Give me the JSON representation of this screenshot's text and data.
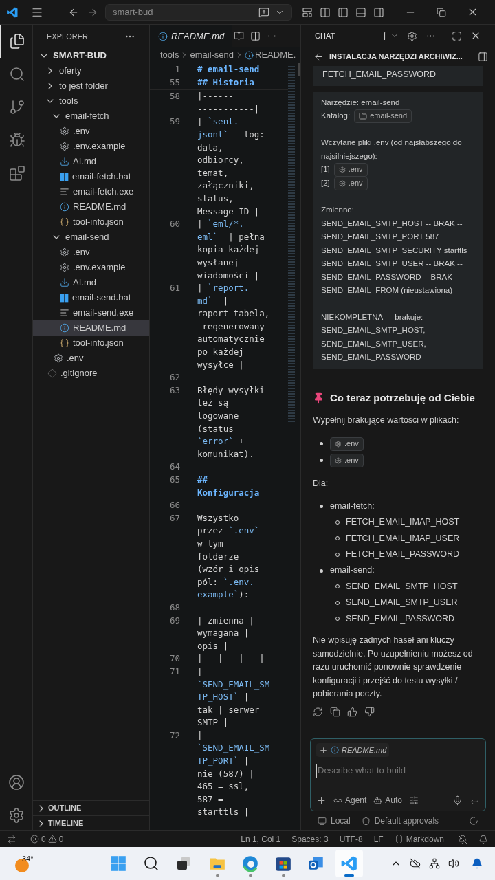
{
  "title_bar": {
    "command_center": "smart-bud"
  },
  "activity_bar": {
    "items": [
      {
        "kind": "explorer",
        "selected": true
      },
      {
        "kind": "search",
        "selected": false
      },
      {
        "kind": "scm",
        "selected": false
      },
      {
        "kind": "debug",
        "selected": false
      },
      {
        "kind": "extensions",
        "selected": false
      }
    ]
  },
  "explorer": {
    "title": "EXPLORER",
    "root": {
      "label": "SMART-BUD",
      "kind": "folder",
      "expanded": true,
      "selected": false,
      "children": [
        {
          "label": "oferty",
          "kind": "folder",
          "expanded": false,
          "selected": false
        },
        {
          "label": "to jest folder",
          "kind": "folder",
          "expanded": false,
          "selected": false
        },
        {
          "label": "tools",
          "kind": "folder",
          "expanded": true,
          "selected": false,
          "children": [
            {
              "label": "email-fetch",
              "kind": "folder",
              "expanded": true,
              "selected": false,
              "children": [
                {
                  "label": ".env",
                  "kind": "env",
                  "selected": false
                },
                {
                  "label": ".env.example",
                  "kind": "env",
                  "selected": false
                },
                {
                  "label": "AI.md",
                  "kind": "download",
                  "selected": false
                },
                {
                  "label": "email-fetch.bat",
                  "kind": "batch",
                  "selected": false
                },
                {
                  "label": "email-fetch.exe",
                  "kind": "exe",
                  "selected": false
                },
                {
                  "label": "README.md",
                  "kind": "info",
                  "selected": false
                },
                {
                  "label": "tool-info.json",
                  "kind": "json",
                  "selected": false
                }
              ]
            },
            {
              "label": "email-send",
              "kind": "folder",
              "expanded": true,
              "selected": false,
              "children": [
                {
                  "label": ".env",
                  "kind": "env",
                  "selected": false
                },
                {
                  "label": ".env.example",
                  "kind": "env",
                  "selected": false
                },
                {
                  "label": "AI.md",
                  "kind": "download",
                  "selected": false
                },
                {
                  "label": "email-send.bat",
                  "kind": "batch",
                  "selected": false
                },
                {
                  "label": "email-send.exe",
                  "kind": "exe",
                  "selected": false
                },
                {
                  "label": "README.md",
                  "kind": "info",
                  "selected": true
                },
                {
                  "label": "tool-info.json",
                  "kind": "json",
                  "selected": false
                }
              ]
            },
            {
              "label": ".env",
              "kind": "env",
              "selected": false
            }
          ]
        },
        {
          "label": ".gitignore",
          "kind": "ignore",
          "selected": false
        }
      ]
    },
    "sections": [
      {
        "label": "OUTLINE",
        "expanded": false
      },
      {
        "label": "TIMELINE",
        "expanded": false
      }
    ]
  },
  "editor": {
    "tab": {
      "label": "README.md",
      "preview": true,
      "selected": true
    },
    "breadcrumb": [
      "tools",
      "email-send",
      "README."
    ],
    "sticky_lines": [
      {
        "number": "1",
        "rows": [
          "# email-send"
        ]
      },
      {
        "number": "55",
        "rows": [
          "## Historia"
        ]
      }
    ],
    "lines": [
      {
        "number": "58",
        "kind": "text",
        "rows": [
          "|------|",
          "-----------|"
        ]
      },
      {
        "number": "59",
        "kind": "text",
        "rows": [
          [
            {
              "text": "| ",
              "kind": "plain"
            },
            {
              "text": "`sent.",
              "kind": "code"
            }
          ],
          [
            {
              "text": "jsonl`",
              "kind": "code"
            },
            {
              "text": " | log:",
              "kind": "plain"
            }
          ],
          "data,",
          "odbiorcy,",
          "temat,",
          "załączniki,",
          "status,",
          "Message-ID |"
        ]
      },
      {
        "number": "60",
        "kind": "text",
        "rows": [
          [
            {
              "text": "| ",
              "kind": "plain"
            },
            {
              "text": "`eml/*.",
              "kind": "code"
            }
          ],
          [
            {
              "text": "eml`",
              "kind": "code"
            },
            {
              "text": "  | pełna",
              "kind": "plain"
            }
          ],
          "kopia każdej",
          "wysłanej",
          "wiadomości |"
        ]
      },
      {
        "number": "61",
        "kind": "text",
        "rows": [
          [
            {
              "text": "| ",
              "kind": "plain"
            },
            {
              "text": "`report.",
              "kind": "code"
            }
          ],
          [
            {
              "text": "md`",
              "kind": "code"
            },
            {
              "text": "  |",
              "kind": "plain"
            }
          ],
          "raport-tabela,",
          " regenerowany",
          "automatycznie",
          "po każdej",
          "wysyłce |"
        ]
      },
      {
        "number": "62",
        "kind": "text"
      },
      {
        "number": "63",
        "kind": "text",
        "rows": [
          "Błędy wysyłki",
          "też są",
          "logowane",
          "(status",
          [
            {
              "text": "`error`",
              "kind": "code"
            },
            {
              "text": " +",
              "kind": "plain"
            }
          ],
          "komunikat)."
        ]
      },
      {
        "number": "64",
        "kind": "text"
      },
      {
        "number": "65",
        "kind": "heading",
        "rows": [
          "##",
          "Konfiguracja"
        ]
      },
      {
        "number": "66",
        "kind": "text"
      },
      {
        "number": "67",
        "kind": "text",
        "rows": [
          "Wszystko",
          [
            {
              "text": "przez ",
              "kind": "plain"
            },
            {
              "text": "`.env`",
              "kind": "code"
            }
          ],
          "w tym",
          "folderze",
          "(wzór i opis",
          [
            {
              "text": "pól: ",
              "kind": "plain"
            },
            {
              "text": "`.env.",
              "kind": "code"
            }
          ],
          [
            {
              "text": "example`",
              "kind": "code"
            },
            {
              "text": "):",
              "kind": "plain"
            }
          ]
        ]
      },
      {
        "number": "68",
        "kind": "text"
      },
      {
        "number": "69",
        "kind": "text",
        "rows": [
          "| zmienna |",
          "wymagana |",
          "opis |"
        ]
      },
      {
        "number": "70",
        "kind": "text",
        "rows": [
          "|---|---|---|"
        ]
      },
      {
        "number": "71",
        "kind": "text",
        "rows": [
          "|",
          [
            {
              "text": "`SEND_EMAIL_SM",
              "kind": "code"
            }
          ],
          [
            {
              "text": "TP_HOST`",
              "kind": "code"
            },
            {
              "text": " |",
              "kind": "plain"
            }
          ],
          "tak | serwer",
          "SMTP |"
        ]
      },
      {
        "number": "72",
        "kind": "text",
        "rows": [
          "|",
          [
            {
              "text": "`SEND_EMAIL_SM",
              "kind": "code"
            }
          ],
          [
            {
              "text": "TP_PORT`",
              "kind": "code"
            },
            {
              "text": " |",
              "kind": "plain"
            }
          ],
          "nie (587) |",
          "465 = ssl,",
          "587 =",
          "starttls |"
        ]
      }
    ]
  },
  "chat": {
    "tab": "CHAT",
    "title": "INSTALACJA NARZĘDZI ARCHIWIZ...",
    "previous_card": [
      "FETCH_EMAIL_PASSWORD"
    ],
    "report": {
      "tool_line": "Narzędzie: email-send",
      "catalog_label": "Katalog:",
      "catalog_chip": "email-send",
      "loaded_title": "Wczytane pliki .env (od najsłabszego do najsilniejszego):",
      "loaded_files": [
        {
          "index": "[1]",
          "chip": ".env"
        },
        {
          "index": "[2]",
          "chip": ".env"
        }
      ],
      "variables_title": "Zmienne:",
      "variables": [
        "SEND_EMAIL_SMTP_HOST -- BRAK --",
        "SEND_EMAIL_SMTP_PORT 587",
        "SEND_EMAIL_SMTP_SECURITY starttls",
        "SEND_EMAIL_SMTP_USER -- BRAK --",
        "SEND_EMAIL_PASSWORD -- BRAK --",
        "SEND_EMAIL_FROM (nieustawiona)"
      ],
      "missing_title": "NIEKOMPLETNA — brakuje:",
      "missing": [
        "SEND_EMAIL_SMTP_HOST,",
        "SEND_EMAIL_SMTP_USER,",
        "SEND_EMAIL_PASSWORD"
      ]
    },
    "heading": "Co teraz potrzebuję od Ciebie",
    "fill_text": "Wypełnij brakujące wartości w plikach:",
    "files": [
      ".env",
      ".env"
    ],
    "for_label": "Dla:",
    "tools": [
      {
        "label": "email-fetch:",
        "children": [
          "FETCH_EMAIL_IMAP_HOST",
          "FETCH_EMAIL_IMAP_USER",
          "FETCH_EMAIL_PASSWORD"
        ]
      },
      {
        "label": "email-send:",
        "children": [
          "SEND_EMAIL_SMTP_HOST",
          "SEND_EMAIL_SMTP_USER",
          "SEND_EMAIL_PASSWORD"
        ]
      }
    ],
    "closing": "Nie wpisuję żadnych haseł ani kluczy samodzielnie. Po uzupełnieniu możesz od razu uruchomić ponownie sprawdzenie konfiguracji i przejść do testu wysyłki / pobierania poczty.",
    "input": {
      "attachment": "README.md",
      "placeholder": "Describe what to build",
      "mode": "Agent",
      "model": "Auto"
    },
    "footer": {
      "location": "Local",
      "approvals": "Default approvals"
    }
  },
  "status_bar": {
    "errors": "0",
    "warnings": "0",
    "position": "Ln 1, Col 1",
    "indent": "Spaces: 3",
    "encoding": "UTF-8",
    "eol": "LF",
    "language": "Markdown"
  },
  "taskbar": {
    "weather": "34°",
    "apps": [
      {
        "kind": "start",
        "running": false,
        "active": false
      },
      {
        "kind": "search",
        "running": false,
        "active": false
      },
      {
        "kind": "taskview",
        "running": false,
        "active": false
      },
      {
        "kind": "files",
        "running": true,
        "active": false
      },
      {
        "kind": "browser",
        "running": true,
        "active": false
      },
      {
        "kind": "store",
        "running": true,
        "active": false
      },
      {
        "kind": "mail",
        "running": false,
        "active": false
      },
      {
        "kind": "editor",
        "running": true,
        "active": true
      }
    ]
  }
}
